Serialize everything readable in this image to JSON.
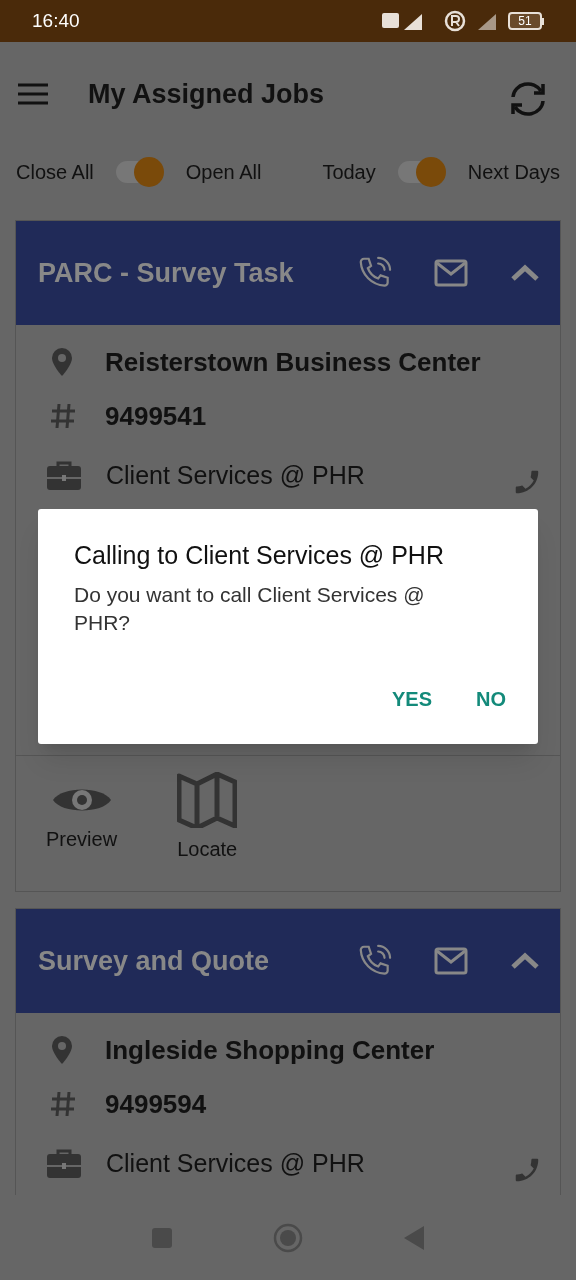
{
  "status_bar": {
    "time": "16:40",
    "battery": "51"
  },
  "app_bar": {
    "title": "My Assigned Jobs"
  },
  "toggles": [
    {
      "left": "Close All",
      "right": "Open All",
      "on": true
    },
    {
      "left": "Today",
      "right": "Next Days",
      "on": true
    }
  ],
  "jobs": [
    {
      "title": "PARC - Survey Task",
      "location": "Reisterstown Business Center",
      "number": "9499541",
      "contact": "Client Services @ PHR",
      "expanded": true,
      "actions": [
        "Preview",
        "Locate"
      ]
    },
    {
      "title": "Survey and Quote",
      "location": "Ingleside Shopping Center",
      "number": "9499594",
      "contact": "Client Services @ PHR",
      "expanded": true
    }
  ],
  "dialog": {
    "title": "Calling to Client Services @ PHR",
    "message": "Do you want to call Client Services @ PHR?",
    "buttons": [
      "YES",
      "NO"
    ]
  }
}
